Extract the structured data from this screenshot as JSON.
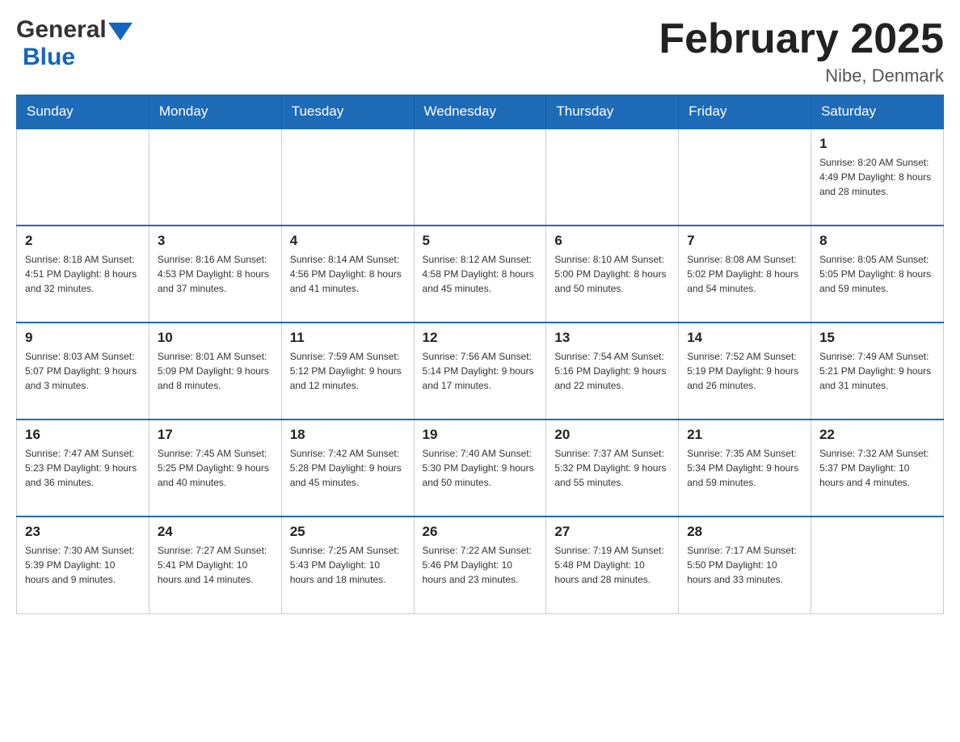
{
  "header": {
    "logo_general": "General",
    "logo_blue": "Blue",
    "title": "February 2025",
    "location": "Nibe, Denmark"
  },
  "days_of_week": [
    "Sunday",
    "Monday",
    "Tuesday",
    "Wednesday",
    "Thursday",
    "Friday",
    "Saturday"
  ],
  "weeks": [
    {
      "days": [
        {
          "number": "",
          "info": ""
        },
        {
          "number": "",
          "info": ""
        },
        {
          "number": "",
          "info": ""
        },
        {
          "number": "",
          "info": ""
        },
        {
          "number": "",
          "info": ""
        },
        {
          "number": "",
          "info": ""
        },
        {
          "number": "1",
          "info": "Sunrise: 8:20 AM\nSunset: 4:49 PM\nDaylight: 8 hours\nand 28 minutes."
        }
      ]
    },
    {
      "days": [
        {
          "number": "2",
          "info": "Sunrise: 8:18 AM\nSunset: 4:51 PM\nDaylight: 8 hours\nand 32 minutes."
        },
        {
          "number": "3",
          "info": "Sunrise: 8:16 AM\nSunset: 4:53 PM\nDaylight: 8 hours\nand 37 minutes."
        },
        {
          "number": "4",
          "info": "Sunrise: 8:14 AM\nSunset: 4:56 PM\nDaylight: 8 hours\nand 41 minutes."
        },
        {
          "number": "5",
          "info": "Sunrise: 8:12 AM\nSunset: 4:58 PM\nDaylight: 8 hours\nand 45 minutes."
        },
        {
          "number": "6",
          "info": "Sunrise: 8:10 AM\nSunset: 5:00 PM\nDaylight: 8 hours\nand 50 minutes."
        },
        {
          "number": "7",
          "info": "Sunrise: 8:08 AM\nSunset: 5:02 PM\nDaylight: 8 hours\nand 54 minutes."
        },
        {
          "number": "8",
          "info": "Sunrise: 8:05 AM\nSunset: 5:05 PM\nDaylight: 8 hours\nand 59 minutes."
        }
      ]
    },
    {
      "days": [
        {
          "number": "9",
          "info": "Sunrise: 8:03 AM\nSunset: 5:07 PM\nDaylight: 9 hours\nand 3 minutes."
        },
        {
          "number": "10",
          "info": "Sunrise: 8:01 AM\nSunset: 5:09 PM\nDaylight: 9 hours\nand 8 minutes."
        },
        {
          "number": "11",
          "info": "Sunrise: 7:59 AM\nSunset: 5:12 PM\nDaylight: 9 hours\nand 12 minutes."
        },
        {
          "number": "12",
          "info": "Sunrise: 7:56 AM\nSunset: 5:14 PM\nDaylight: 9 hours\nand 17 minutes."
        },
        {
          "number": "13",
          "info": "Sunrise: 7:54 AM\nSunset: 5:16 PM\nDaylight: 9 hours\nand 22 minutes."
        },
        {
          "number": "14",
          "info": "Sunrise: 7:52 AM\nSunset: 5:19 PM\nDaylight: 9 hours\nand 26 minutes."
        },
        {
          "number": "15",
          "info": "Sunrise: 7:49 AM\nSunset: 5:21 PM\nDaylight: 9 hours\nand 31 minutes."
        }
      ]
    },
    {
      "days": [
        {
          "number": "16",
          "info": "Sunrise: 7:47 AM\nSunset: 5:23 PM\nDaylight: 9 hours\nand 36 minutes."
        },
        {
          "number": "17",
          "info": "Sunrise: 7:45 AM\nSunset: 5:25 PM\nDaylight: 9 hours\nand 40 minutes."
        },
        {
          "number": "18",
          "info": "Sunrise: 7:42 AM\nSunset: 5:28 PM\nDaylight: 9 hours\nand 45 minutes."
        },
        {
          "number": "19",
          "info": "Sunrise: 7:40 AM\nSunset: 5:30 PM\nDaylight: 9 hours\nand 50 minutes."
        },
        {
          "number": "20",
          "info": "Sunrise: 7:37 AM\nSunset: 5:32 PM\nDaylight: 9 hours\nand 55 minutes."
        },
        {
          "number": "21",
          "info": "Sunrise: 7:35 AM\nSunset: 5:34 PM\nDaylight: 9 hours\nand 59 minutes."
        },
        {
          "number": "22",
          "info": "Sunrise: 7:32 AM\nSunset: 5:37 PM\nDaylight: 10 hours\nand 4 minutes."
        }
      ]
    },
    {
      "days": [
        {
          "number": "23",
          "info": "Sunrise: 7:30 AM\nSunset: 5:39 PM\nDaylight: 10 hours\nand 9 minutes."
        },
        {
          "number": "24",
          "info": "Sunrise: 7:27 AM\nSunset: 5:41 PM\nDaylight: 10 hours\nand 14 minutes."
        },
        {
          "number": "25",
          "info": "Sunrise: 7:25 AM\nSunset: 5:43 PM\nDaylight: 10 hours\nand 18 minutes."
        },
        {
          "number": "26",
          "info": "Sunrise: 7:22 AM\nSunset: 5:46 PM\nDaylight: 10 hours\nand 23 minutes."
        },
        {
          "number": "27",
          "info": "Sunrise: 7:19 AM\nSunset: 5:48 PM\nDaylight: 10 hours\nand 28 minutes."
        },
        {
          "number": "28",
          "info": "Sunrise: 7:17 AM\nSunset: 5:50 PM\nDaylight: 10 hours\nand 33 minutes."
        },
        {
          "number": "",
          "info": ""
        }
      ]
    }
  ]
}
